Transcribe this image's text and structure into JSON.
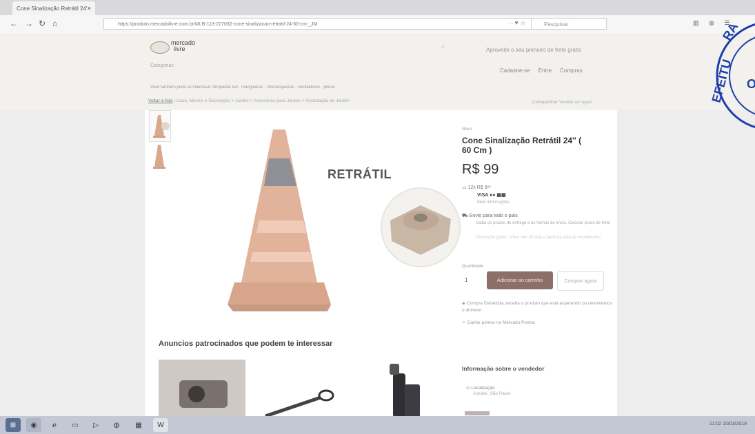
{
  "browser": {
    "tab_title": "Cone Sinalização Retrátil 24'",
    "tab_close": "×",
    "url": "https://produto.mercadolivre.com.br/MLB-113-227032-cone-sinalizacao-retratil-24-60-cm-_JM",
    "search_placeholder": "Pesquisar",
    "url_icons": "··· ♥ ☆"
  },
  "header": {
    "logo_text_1": "mercado",
    "logo_text_2": "livre",
    "search_placeholder": "Categorias",
    "promo": "Aproveite o seu primeiro de frete gratis",
    "user_links": "Cadastre-se  Entre  Compras",
    "breadcrumb": "Você também pode se interessar: lâmpadas led · mangueiras · churrasqueiras · ventiladores · pneus"
  },
  "category_bar": {
    "first": "Voltar à lista",
    "rest": "  |  Casa, Móveis e Decoração  >  Jardim  >  Acessórios para Jardim  >  Sinalização de Jardim",
    "share": "Compartilhar   Vender um igual"
  },
  "product": {
    "condition": "Novo",
    "title": "Cone Sinalização Retrátil 24'' ( 60 Cm )",
    "price": "R$ 99",
    "installments": "12x R$ 9⁸⁵",
    "card_logos": "VISA  ●●  ▦▦",
    "more_info": "Mais informações",
    "shipping": "Envio para todo o país",
    "shipping_sub": "Saiba os prazos de entrega e as formas de envio. Calcular prazo de frete",
    "return_sub": "Devolução grátis · Você tem 30 dias a partir da data de recebimento",
    "qty_label": "Quantidade",
    "qty_value": "1",
    "add_cart": "Adicionar ao carrinho",
    "buy_now": "Comprar agora",
    "guarantee_1": "Compra Garantida, receba o produto que está esperando ou devolvemos o dinheiro",
    "guarantee_2": "Ganhe pontos no Mercado Pontos",
    "image_label": "RETRÁTIL"
  },
  "seller": {
    "heading": "Informação sobre o vendedor",
    "location_label": "Localização",
    "location_value": "Jundiaí, São Paulo"
  },
  "sponsored": {
    "heading": "Anuncios patrocinados que podem te interessar"
  },
  "taskbar": {
    "clock": "11:02  15/03/2019"
  },
  "stamp": {
    "text": "PREFEITURA"
  },
  "colors": {
    "stamp_blue": "#1f3fa8",
    "add_cart_bg": "#8c7068",
    "cone_orange": "#d9a88e"
  }
}
